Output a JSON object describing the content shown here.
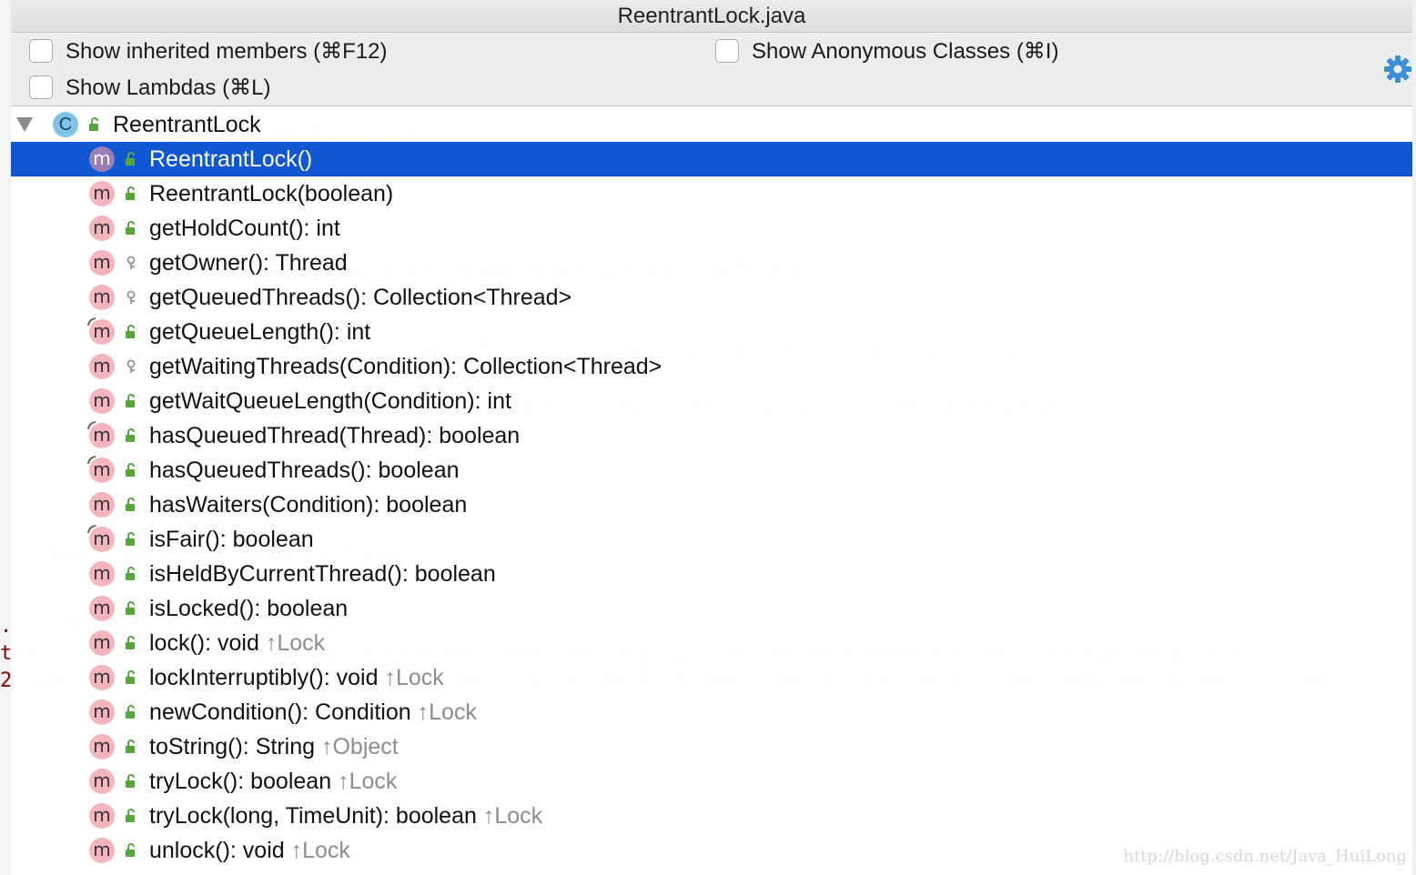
{
  "window": {
    "title": "ReentrantLock.java"
  },
  "options": {
    "inherited": "Show inherited members (⌘F12)",
    "anonymous": "Show Anonymous Classes (⌘I)",
    "lambdas": "Show Lambdas (⌘L)"
  },
  "tree": {
    "root": {
      "label": "ReentrantLock",
      "icon": "C"
    },
    "members": [
      {
        "label": "ReentrantLock()",
        "inherited": "",
        "visibility": "public",
        "override": false
      },
      {
        "label": "ReentrantLock(boolean)",
        "inherited": "",
        "visibility": "public",
        "override": false
      },
      {
        "label": "getHoldCount(): int",
        "inherited": "",
        "visibility": "public",
        "override": false
      },
      {
        "label": "getOwner(): Thread",
        "inherited": "",
        "visibility": "protected",
        "override": false
      },
      {
        "label": "getQueuedThreads(): Collection<Thread>",
        "inherited": "",
        "visibility": "protected",
        "override": false
      },
      {
        "label": "getQueueLength(): int",
        "inherited": "",
        "visibility": "public",
        "override": true
      },
      {
        "label": "getWaitingThreads(Condition): Collection<Thread>",
        "inherited": "",
        "visibility": "protected",
        "override": false
      },
      {
        "label": "getWaitQueueLength(Condition): int",
        "inherited": "",
        "visibility": "public",
        "override": false
      },
      {
        "label": "hasQueuedThread(Thread): boolean",
        "inherited": "",
        "visibility": "public",
        "override": true
      },
      {
        "label": "hasQueuedThreads(): boolean",
        "inherited": "",
        "visibility": "public",
        "override": true
      },
      {
        "label": "hasWaiters(Condition): boolean",
        "inherited": "",
        "visibility": "public",
        "override": false
      },
      {
        "label": "isFair(): boolean",
        "inherited": "",
        "visibility": "public",
        "override": true
      },
      {
        "label": "isHeldByCurrentThread(): boolean",
        "inherited": "",
        "visibility": "public",
        "override": false
      },
      {
        "label": "isLocked(): boolean",
        "inherited": "",
        "visibility": "public",
        "override": false
      },
      {
        "label": "lock(): void",
        "inherited": "↑Lock",
        "visibility": "public",
        "override": false
      },
      {
        "label": "lockInterruptibly(): void",
        "inherited": "↑Lock",
        "visibility": "public",
        "override": false
      },
      {
        "label": "newCondition(): Condition",
        "inherited": "↑Lock",
        "visibility": "public",
        "override": false
      },
      {
        "label": "toString(): String",
        "inherited": "↑Object",
        "visibility": "public",
        "override": false
      },
      {
        "label": "tryLock(): boolean",
        "inherited": "↑Lock",
        "visibility": "public",
        "override": false
      },
      {
        "label": "tryLock(long, TimeUnit): boolean",
        "inherited": "↑Lock",
        "visibility": "public",
        "override": false
      },
      {
        "label": "unlock(): void",
        "inherited": "↑Lock",
        "visibility": "public",
        "override": false
      }
    ],
    "method_icon": "m",
    "selected_index": 0
  },
  "background_code": [
    "    /**",
    "     * Creates an instance of {@code ReentrantLock}.",
    "     * This is equivalent to using {@code ReentrantLock(false)}.",
    "    public ReentrantLock() {",
    "        sync = new NonfairSync();",
    "     * Creates an instance of {@code ReentrantLock} with the",
    "     * @param fair {@code true} if this lock should use a fair ordering policy",
    "    public ReentrantLock(boolean fair) { sync = fair ? new FairSync() : new NonfairSync(); }",
    "  ReentrantLock > ReentrantLock()",
    "  .jdk/Contents/Home/jre/lib ...",
    "ted in both /Library/Java/JavaVirtualMachines/jdk1.8.0_121.jdk/Contents/Home/bin/java (0x101b7e4c0) and",
    "21.jdk/Contents/Home/jre/lib/libinstrument.dylib (0x101c024e0). One of the two will be used. Which one is undefi"
  ],
  "watermark": "http://blog.csdn.net/Java_HuiLong",
  "colors": {
    "selection": "#1057d4",
    "method_badge": "#f5b5bd",
    "class_badge": "#7fc4e6",
    "public_lock": "#57a639"
  }
}
